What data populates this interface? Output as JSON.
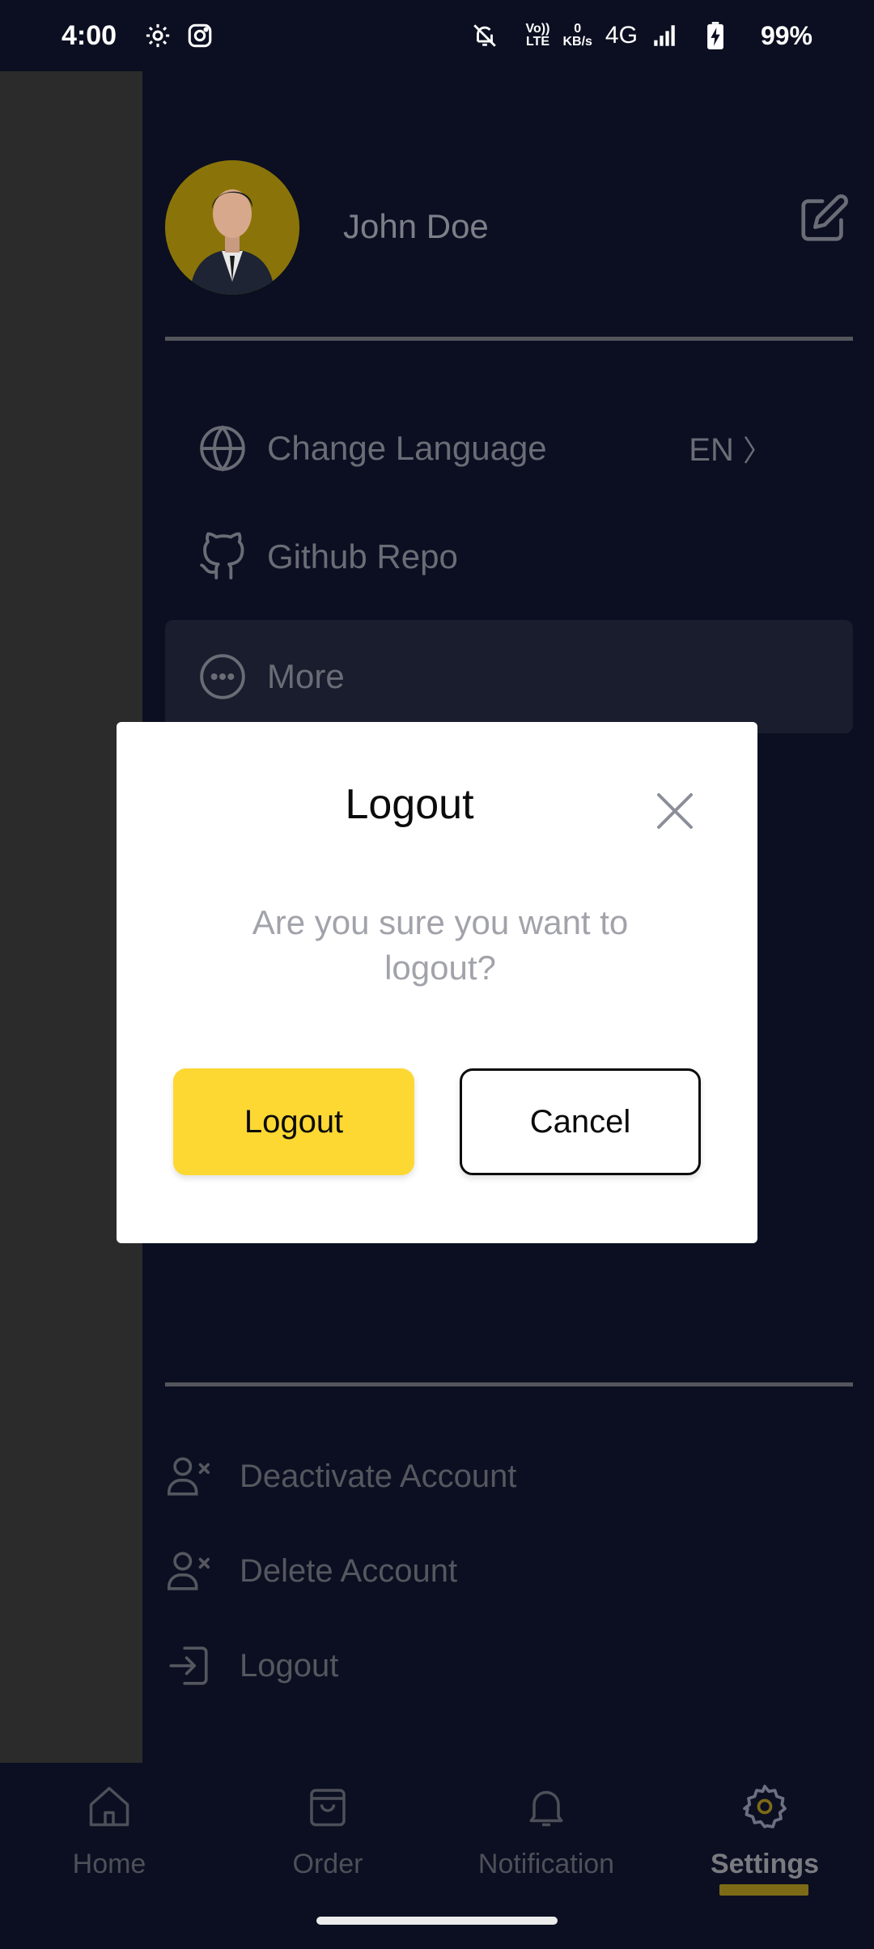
{
  "status_bar": {
    "time": "4:00",
    "data_speed_value": "0",
    "data_speed_unit": "KB/s",
    "volte": "Vo))",
    "lte": "LTE",
    "network": "4G",
    "battery": "99%"
  },
  "profile": {
    "name": "John Doe"
  },
  "menu": [
    {
      "label": "Change Language",
      "value": "EN",
      "icon": "globe-icon"
    },
    {
      "label": "Github Repo",
      "icon": "github-icon"
    },
    {
      "label": "More",
      "icon": "more-icon"
    }
  ],
  "account_actions": [
    {
      "label": "Deactivate Account",
      "icon": "user-x-icon"
    },
    {
      "label": "Delete Account",
      "icon": "user-x-icon"
    },
    {
      "label": "Logout",
      "icon": "logout-icon"
    }
  ],
  "nav": {
    "home": "Home",
    "order": "Order",
    "notification": "Notification",
    "settings": "Settings",
    "active": "settings"
  },
  "dialog": {
    "title": "Logout",
    "message": "Are you sure you want to logout?",
    "confirm_label": "Logout",
    "cancel_label": "Cancel"
  },
  "colors": {
    "background": "#0b0f21",
    "accent": "#fdd833",
    "scrim": "#2b2b2b"
  }
}
